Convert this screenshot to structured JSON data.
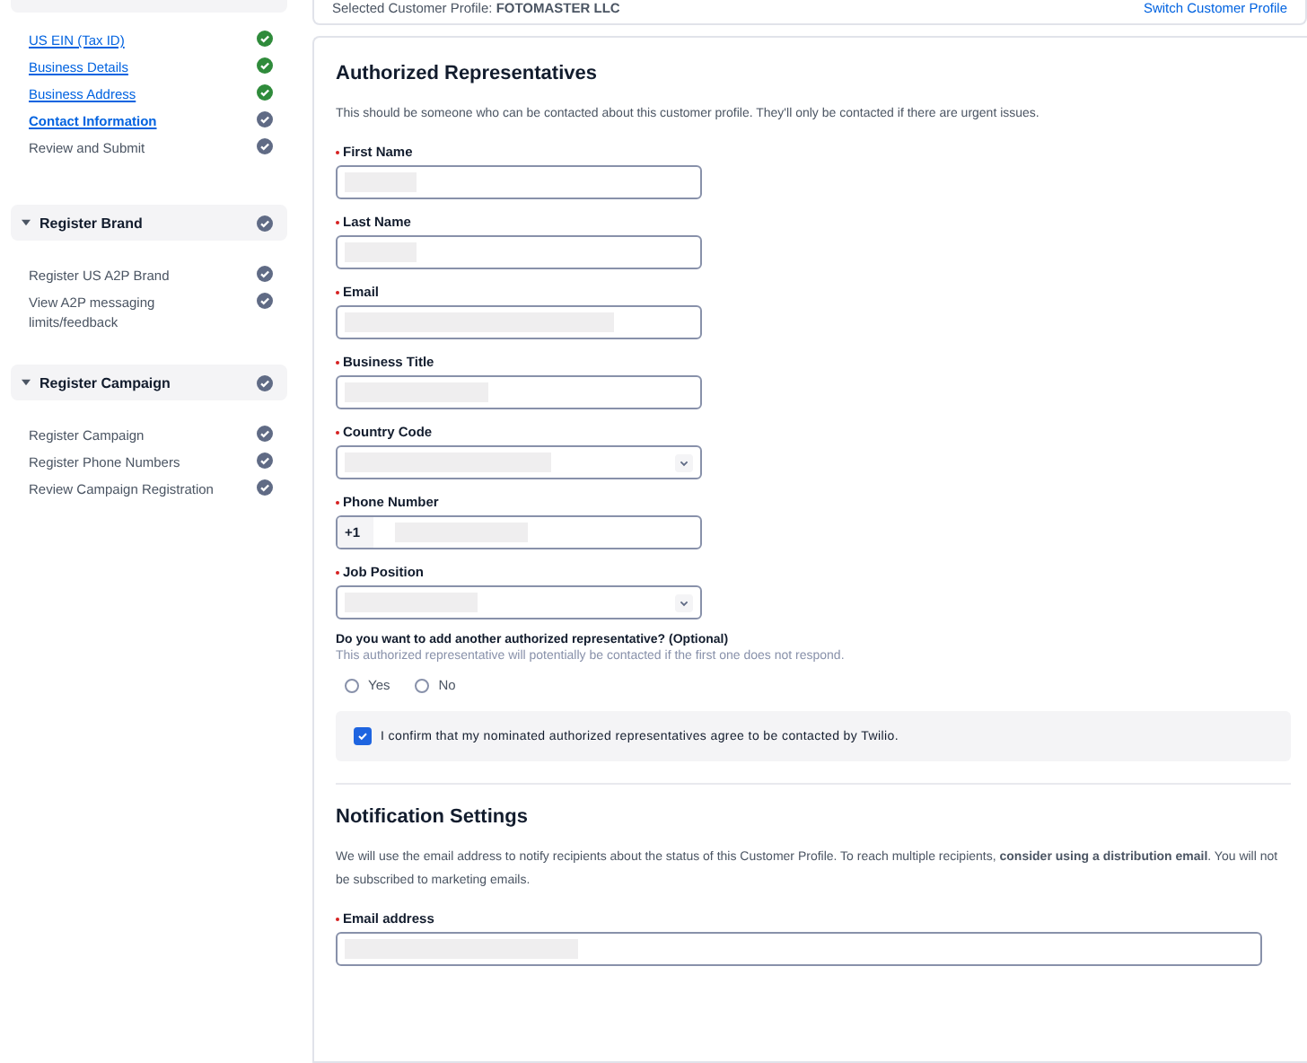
{
  "sidebar": {
    "sections": [
      {
        "items": [
          {
            "label": "US EIN (Tax ID)",
            "kind": "link",
            "selected": false,
            "complete": true
          },
          {
            "label": "Business Details",
            "kind": "link",
            "selected": false,
            "complete": true
          },
          {
            "label": "Business Address",
            "kind": "link",
            "selected": false,
            "complete": true
          },
          {
            "label": "Contact Information",
            "kind": "link",
            "selected": true,
            "complete": false
          },
          {
            "label": "Review and Submit",
            "kind": "plain",
            "selected": false,
            "complete": false
          }
        ]
      },
      {
        "title": "Register Brand",
        "expanded": true,
        "complete": false,
        "items": [
          {
            "label": "Register US A2P Brand",
            "kind": "plain",
            "selected": false,
            "complete": false
          },
          {
            "label": "View A2P messaging limits/feedback",
            "kind": "plain",
            "selected": false,
            "complete": false
          }
        ]
      },
      {
        "title": "Register Campaign",
        "expanded": true,
        "complete": false,
        "items": [
          {
            "label": "Register Campaign",
            "kind": "plain",
            "selected": false,
            "complete": false
          },
          {
            "label": "Register Phone Numbers",
            "kind": "plain",
            "selected": false,
            "complete": false
          },
          {
            "label": "Review Campaign Registration",
            "kind": "plain",
            "selected": false,
            "complete": false
          }
        ]
      }
    ]
  },
  "profile_bar": {
    "label": "Selected Customer Profile:",
    "value": "FOTOMASTER LLC",
    "link": "Switch Customer Profile"
  },
  "representatives": {
    "title": "Authorized Representatives",
    "description": "This should be someone who can be contacted about this customer profile. They'll only be contacted if there are urgent issues.",
    "fields": [
      {
        "label": "First Name",
        "kind": "text",
        "required": true
      },
      {
        "label": "Last Name",
        "kind": "text",
        "required": true
      },
      {
        "label": "Email",
        "kind": "text",
        "required": true
      },
      {
        "label": "Business Title",
        "kind": "text",
        "required": true
      },
      {
        "label": "Country Code",
        "kind": "select",
        "required": true
      },
      {
        "label": "Phone Number",
        "kind": "phone",
        "required": true,
        "prefix": "+1"
      },
      {
        "label": "Job Position",
        "kind": "select",
        "required": true
      }
    ],
    "question": {
      "title": "Do you want to add another authorized representative? (Optional)",
      "hint": "This authorized representative will potentially be contacted if the first one does not respond.",
      "options": [
        {
          "label": "Yes",
          "selected": false
        },
        {
          "label": "No",
          "selected": false
        }
      ]
    },
    "consent": {
      "label": "I confirm that my nominated authorized representatives agree to be contacted by Twilio.",
      "checked": true
    }
  },
  "notifications": {
    "title": "Notification Settings",
    "description": "We will use the email address to notify recipients about the status of this Customer Profile. To reach multiple recipients, **consider using a distribution email**. You will not be subscribed to marketing emails.",
    "field": {
      "label": "Email address",
      "required": true
    }
  }
}
